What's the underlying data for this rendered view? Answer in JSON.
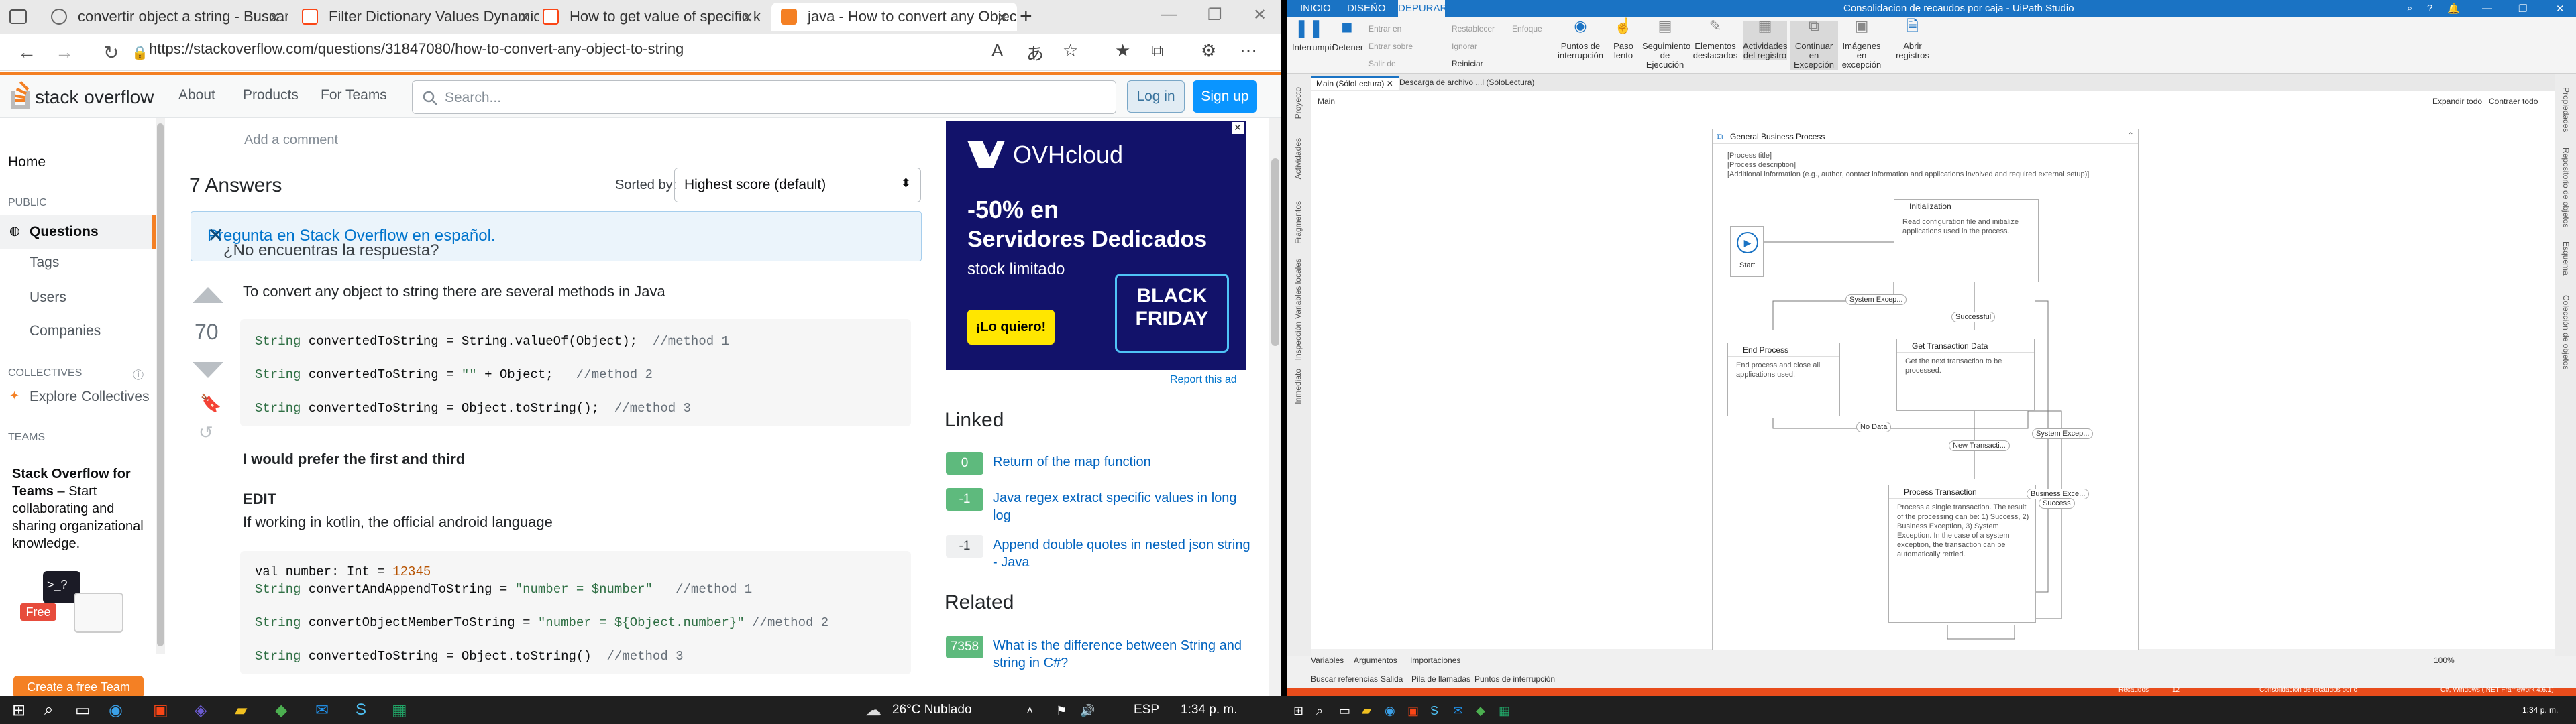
{
  "edge": {
    "tabs": [
      {
        "label": "convertir object a string - Buscar",
        "icon": "bing-icon"
      },
      {
        "label": "Filter Dictionary Values Dynamic...",
        "icon": "uipath-forum-icon"
      },
      {
        "label": "How to get value of specific key",
        "icon": "uipath-forum-icon"
      },
      {
        "label": "java - How to convert any Objec",
        "icon": "stackoverflow-icon"
      }
    ],
    "url": "https://stackoverflow.com/questions/31847080/how-to-convert-any-object-to-string"
  },
  "so": {
    "logo": "stack overflow",
    "nav": [
      "About",
      "Products",
      "For Teams"
    ],
    "search_placeholder": "Search...",
    "login": "Log in",
    "signup": "Sign up",
    "sidebar": {
      "home": "Home",
      "public": "PUBLIC",
      "questions": "Questions",
      "tags": "Tags",
      "users": "Users",
      "companies": "Companies",
      "collectives": "COLLECTIVES",
      "explore": "Explore Collectives",
      "teams": "TEAMS",
      "teams_title": "Stack Overflow for Teams",
      "teams_text": " – Start collaborating and sharing organizational knowledge.",
      "free": "Free",
      "create": "Create a free Team"
    },
    "add_comment": "Add a comment",
    "answers_count": "7 Answers",
    "sort_label": "Sorted by:",
    "sort_value": "Highest score (default)",
    "notice_text": "¿No encuentras la respuesta? ",
    "notice_link": "Pregunta en Stack Overflow en español.",
    "score": "70",
    "intro": "To convert any object to string there are several methods in Java",
    "code1": [
      [
        "String",
        " convertedToString = String.valueOf(Object);  ",
        "//method 1"
      ],
      [
        "String",
        " convertedToString = ",
        "\"\"",
        " + Object;   ",
        "//method 2"
      ],
      [
        "String",
        " convertedToString = Object.toString();  ",
        "//method 3"
      ]
    ],
    "prefer": "I would prefer the first and third",
    "edit": "EDIT",
    "kotlin": "If working in kotlin, the official android language",
    "code2": {
      "l1a": "val number: Int = ",
      "l1b": "12345",
      "l2a": "String",
      "l2b": " convertAndAppendToString = ",
      "l2c": "\"number = $number\"",
      "l2d": "   //method 1",
      "l3a": "String",
      "l3b": " convertObjectMemberToString = ",
      "l3c": "\"number = ${Object.number}\"",
      "l3d": " //method 2",
      "l4a": "String",
      "l4b": " convertedToString = Object.toString()  ",
      "l4c": "//method 3"
    },
    "ad": {
      "brand": "OVHcloud",
      "line1": "-50% en",
      "line2": "Servidores Dedicados",
      "line3": "stock limitado",
      "cta": "¡Lo quiero!",
      "badge1": "BLACK",
      "badge2": "FRIDAY",
      "report": "Report this ad"
    },
    "linked_h": "Linked",
    "linked": [
      {
        "score": "0",
        "title": "Return of the map function",
        "accepted": true
      },
      {
        "score": "-1",
        "title": "Java regex extract specific values in long log",
        "accepted": true
      },
      {
        "score": "-1",
        "title": "Append double quotes in nested json string - Java",
        "accepted": false
      }
    ],
    "related_h": "Related",
    "related": [
      {
        "score": "7358",
        "title": "What is the difference between String and string in C#?"
      }
    ]
  },
  "uipath": {
    "title": "Consolidacion de recaudos por caja - UiPath Studio",
    "tabs": [
      "INICIO",
      "DISEÑO",
      "DEPURAR"
    ],
    "ribbon": {
      "interrumpir": "Interrumpir",
      "detener": "Detener",
      "entrar_en": "Entrar en",
      "entrar_sobre": "Entrar sobre",
      "salir_de": "Salir de",
      "restablecer": "Restablecer",
      "ignorar": "Ignorar",
      "reiniciar": "Reiniciar",
      "enfoque": "Enfoque",
      "puntos": "Puntos de interrupción",
      "paso_lento": "Paso lento",
      "seguimiento": "Seguimiento de Ejecución",
      "elementos": "Elementos destacados",
      "actividades": "Actividades del registro",
      "continuar": "Continuar en Excepción",
      "imagenes": "Imágenes en excepción",
      "abrir": "Abrir registros"
    },
    "doc_tabs": [
      "Main (SóloLectura)",
      "Descarga de archivo ...l (SóloLectura)"
    ],
    "breadcrumb": "Main",
    "expand": "Expandir todo",
    "collapse": "Contraer todo",
    "left_panels": [
      "Proyecto",
      "Actividades",
      "Fragmentos",
      "Variables locales",
      "Inspección",
      "Inmediato"
    ],
    "right_panels": [
      "Propiedades",
      "Repositorio de objetos",
      "Esquema",
      "Colección de objetos"
    ],
    "seq_title": "General Business Process",
    "seq_lines": [
      "[Process title]",
      "[Process description]",
      "[Additional information (e.g., author, contact information and applications involved and required external setup)]"
    ],
    "start": "Start",
    "states": {
      "init_t": "Initialization",
      "init_b": "Read configuration file and initialize applications used in the process.",
      "end_t": "End Process",
      "end_b": "End process and close all applications used.",
      "get_t": "Get Transaction Data",
      "get_b": "Get the next transaction to be processed.",
      "proc_t": "Process Transaction",
      "proc_b": "Process a single transaction. The result of the processing can be: 1) Success, 2) Business Exception, 3) System Exception. In the case of a system exception, the transaction can be automatically retried."
    },
    "labels": {
      "sys_exc1": "System Excep...",
      "successful": "Successful",
      "no_data": "No Data",
      "new_trans": "New Transacti...",
      "sys_exc2": "System Excep...",
      "bus_exc": "Business Exce...",
      "success": "Success"
    },
    "bottom_tabs": [
      "Variables",
      "Argumentos",
      "Importaciones"
    ],
    "bottom_tabs2": [
      "Buscar referencias",
      "Salida",
      "Pila de llamadas",
      "Puntos de interrupción"
    ],
    "zoom": "100%",
    "status": {
      "recaudos": "Recaudos",
      "changes": "12",
      "project": "Consolidacion de recaudos por c",
      "framework": "C#, Windows (.NET Framework 4.6.1)"
    }
  },
  "taskbar": {
    "weather": "26°C  Nublado",
    "lang": "ESP",
    "time": "1:34 p. m.",
    "time2": "1:34 p. m."
  }
}
